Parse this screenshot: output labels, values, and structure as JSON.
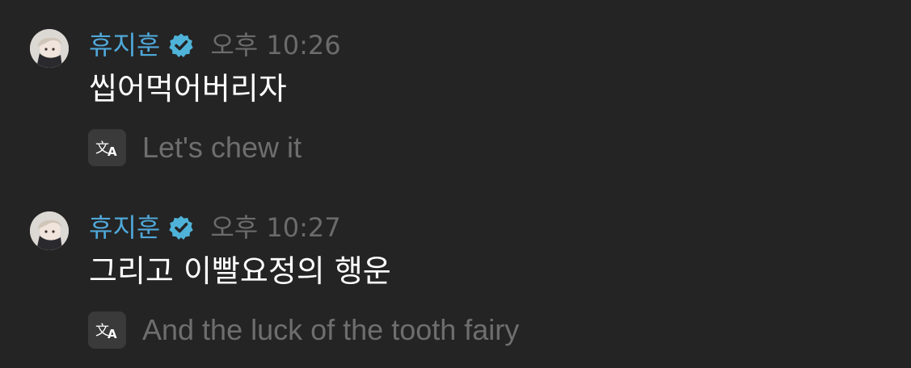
{
  "messages": [
    {
      "author": "휴지훈",
      "verified_icon": "verified-check-icon",
      "time": "오후 10:26",
      "text": "씹어먹어버리자",
      "translate_icon": "translate-icon",
      "translation": "Let's chew it"
    },
    {
      "author": "휴지훈",
      "verified_icon": "verified-check-icon",
      "time": "오후 10:27",
      "text": "그리고 이빨요정의 행운",
      "translate_icon": "translate-icon",
      "translation": "And the luck of the tooth fairy"
    }
  ],
  "colors": {
    "background": "#242424",
    "author": "#4fa8d9",
    "verified": "#4fb3d9",
    "timestamp": "#6b6b6b",
    "message_text": "#ffffff",
    "translation_text": "#6e6e6e",
    "translate_button_bg": "#3a3a3a"
  }
}
